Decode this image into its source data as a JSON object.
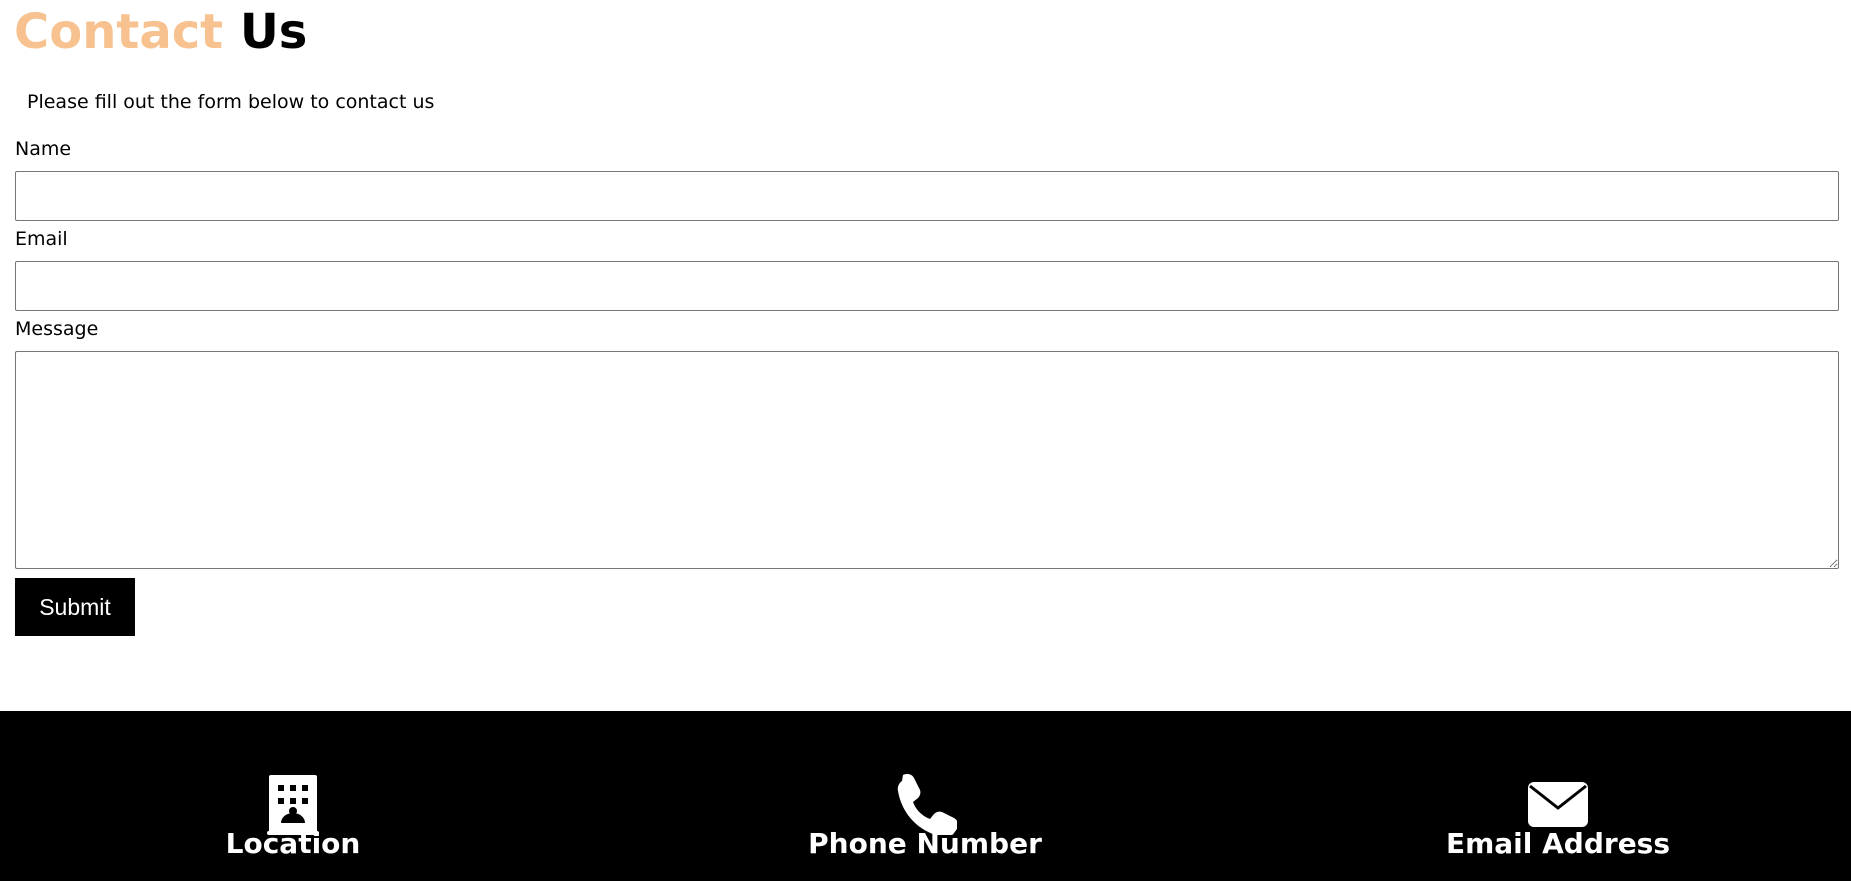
{
  "header": {
    "title_accent": "Contact",
    "title_rest": "Us",
    "accent_color": "#f7c28f"
  },
  "intro": {
    "text": "Please fill out the form below to contact us"
  },
  "form": {
    "name_label": "Name",
    "name_value": "",
    "email_label": "Email",
    "email_value": "",
    "message_label": "Message",
    "message_value": "",
    "submit_label": "Submit"
  },
  "footer": {
    "background": "#000000",
    "items": [
      {
        "icon": "building-icon",
        "label": "Location"
      },
      {
        "icon": "phone-icon",
        "label": "Phone Number"
      },
      {
        "icon": "envelope-icon",
        "label": "Email Address"
      }
    ]
  }
}
